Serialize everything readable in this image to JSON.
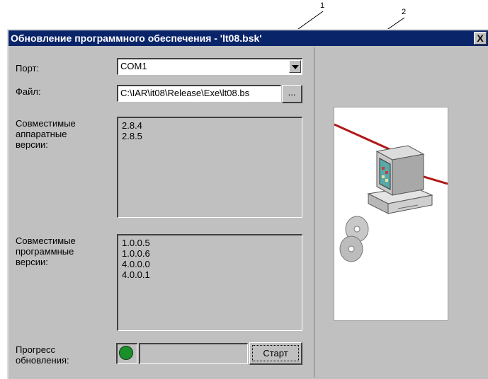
{
  "callouts": {
    "one": "1",
    "two": "2"
  },
  "window": {
    "title": "Обновление программного обеспечения - 'lt08.bsk'",
    "close_label": "X"
  },
  "port": {
    "label": "Порт:",
    "value": "COM1"
  },
  "file": {
    "label": "Файл:",
    "value": "C:\\IAR\\it08\\Release\\Exe\\lt08.bs",
    "browse_label": "..."
  },
  "hw_versions": {
    "label_lines": [
      "Совместимые",
      "аппаратные",
      "версии:"
    ],
    "items": [
      "2.8.4",
      "2.8.5"
    ]
  },
  "sw_versions": {
    "label_lines": [
      "Совместимые",
      "программные",
      "версии:"
    ],
    "items": [
      "1.0.0.5",
      "1.0.0.6",
      "4.0.0.0",
      "4.0.0.1"
    ]
  },
  "progress": {
    "label_lines": [
      "Прогресс",
      "обновления:"
    ],
    "value": 0,
    "start_label": "Старт",
    "status_color": "#1b8f2a"
  },
  "colors": {
    "titlebar": "#0a246a",
    "window_bg": "#c0c0c0",
    "cable": "#b01818"
  }
}
